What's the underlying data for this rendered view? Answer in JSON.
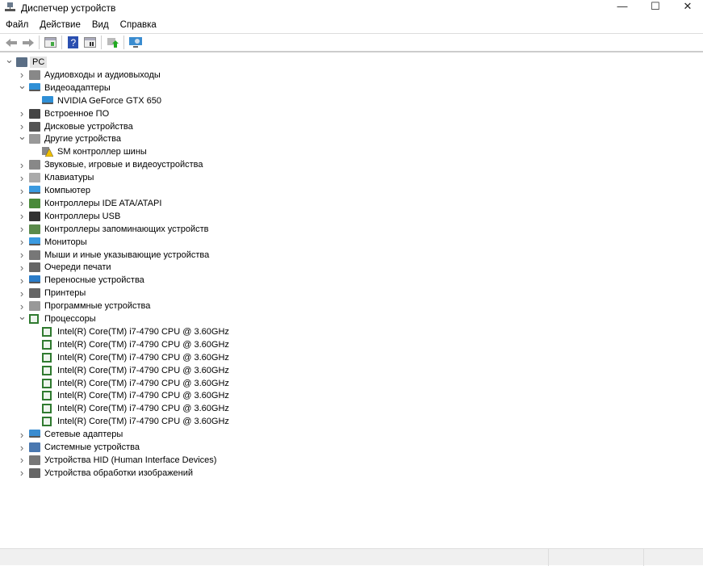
{
  "window": {
    "title": "Диспетчер устройств",
    "minimize": "—",
    "maximize": "☐",
    "close": "✕"
  },
  "menu": [
    "Файл",
    "Действие",
    "Вид",
    "Справка"
  ],
  "toolbar": [
    "back-icon",
    "forward-icon",
    "show-hide-tree-icon",
    "help-icon",
    "properties-icon",
    "update-driver-icon",
    "scan-hardware-icon"
  ],
  "tree": [
    {
      "label": "PC",
      "level": 0,
      "expanded": true,
      "icon": "computer"
    },
    {
      "label": "Аудиовходы и аудиовыходы",
      "level": 1,
      "expanded": false,
      "icon": "audio"
    },
    {
      "label": "Видеоадаптеры",
      "level": 1,
      "expanded": true,
      "icon": "display"
    },
    {
      "label": "NVIDIA GeForce GTX 650",
      "level": 2,
      "icon": "display"
    },
    {
      "label": "Встроенное ПО",
      "level": 1,
      "expanded": false,
      "icon": "firmware"
    },
    {
      "label": "Дисковые устройства",
      "level": 1,
      "expanded": false,
      "icon": "disk"
    },
    {
      "label": "Другие устройства",
      "level": 1,
      "expanded": true,
      "icon": "unknown"
    },
    {
      "label": "SM контроллер шины",
      "level": 2,
      "icon": "warning"
    },
    {
      "label": "Звуковые, игровые и видеоустройства",
      "level": 1,
      "expanded": false,
      "icon": "audio"
    },
    {
      "label": "Клавиатуры",
      "level": 1,
      "expanded": false,
      "icon": "keyboard"
    },
    {
      "label": "Компьютер",
      "level": 1,
      "expanded": false,
      "icon": "monitor"
    },
    {
      "label": "Контроллеры IDE ATA/ATAPI",
      "level": 1,
      "expanded": false,
      "icon": "controller"
    },
    {
      "label": "Контроллеры USB",
      "level": 1,
      "expanded": false,
      "icon": "usb"
    },
    {
      "label": "Контроллеры запоминающих устройств",
      "level": 1,
      "expanded": false,
      "icon": "storage"
    },
    {
      "label": "Мониторы",
      "level": 1,
      "expanded": false,
      "icon": "monitor"
    },
    {
      "label": "Мыши и иные указывающие устройства",
      "level": 1,
      "expanded": false,
      "icon": "mouse"
    },
    {
      "label": "Очереди печати",
      "level": 1,
      "expanded": false,
      "icon": "printer"
    },
    {
      "label": "Переносные устройства",
      "level": 1,
      "expanded": false,
      "icon": "portable"
    },
    {
      "label": "Принтеры",
      "level": 1,
      "expanded": false,
      "icon": "printer"
    },
    {
      "label": "Программные устройства",
      "level": 1,
      "expanded": false,
      "icon": "software"
    },
    {
      "label": "Процессоры",
      "level": 1,
      "expanded": true,
      "icon": "cpu"
    },
    {
      "label": "Intel(R) Core(TM) i7-4790 CPU @ 3.60GHz",
      "level": 2,
      "icon": "cpu"
    },
    {
      "label": "Intel(R) Core(TM) i7-4790 CPU @ 3.60GHz",
      "level": 2,
      "icon": "cpu"
    },
    {
      "label": "Intel(R) Core(TM) i7-4790 CPU @ 3.60GHz",
      "level": 2,
      "icon": "cpu"
    },
    {
      "label": "Intel(R) Core(TM) i7-4790 CPU @ 3.60GHz",
      "level": 2,
      "icon": "cpu"
    },
    {
      "label": "Intel(R) Core(TM) i7-4790 CPU @ 3.60GHz",
      "level": 2,
      "icon": "cpu"
    },
    {
      "label": "Intel(R) Core(TM) i7-4790 CPU @ 3.60GHz",
      "level": 2,
      "icon": "cpu"
    },
    {
      "label": "Intel(R) Core(TM) i7-4790 CPU @ 3.60GHz",
      "level": 2,
      "icon": "cpu"
    },
    {
      "label": "Intel(R) Core(TM) i7-4790 CPU @ 3.60GHz",
      "level": 2,
      "icon": "cpu"
    },
    {
      "label": "Сетевые адаптеры",
      "level": 1,
      "expanded": false,
      "icon": "network"
    },
    {
      "label": "Системные устройства",
      "level": 1,
      "expanded": false,
      "icon": "system"
    },
    {
      "label": "Устройства HID (Human Interface Devices)",
      "level": 1,
      "expanded": false,
      "icon": "hid"
    },
    {
      "label": "Устройства обработки изображений",
      "level": 1,
      "expanded": false,
      "icon": "camera"
    }
  ]
}
